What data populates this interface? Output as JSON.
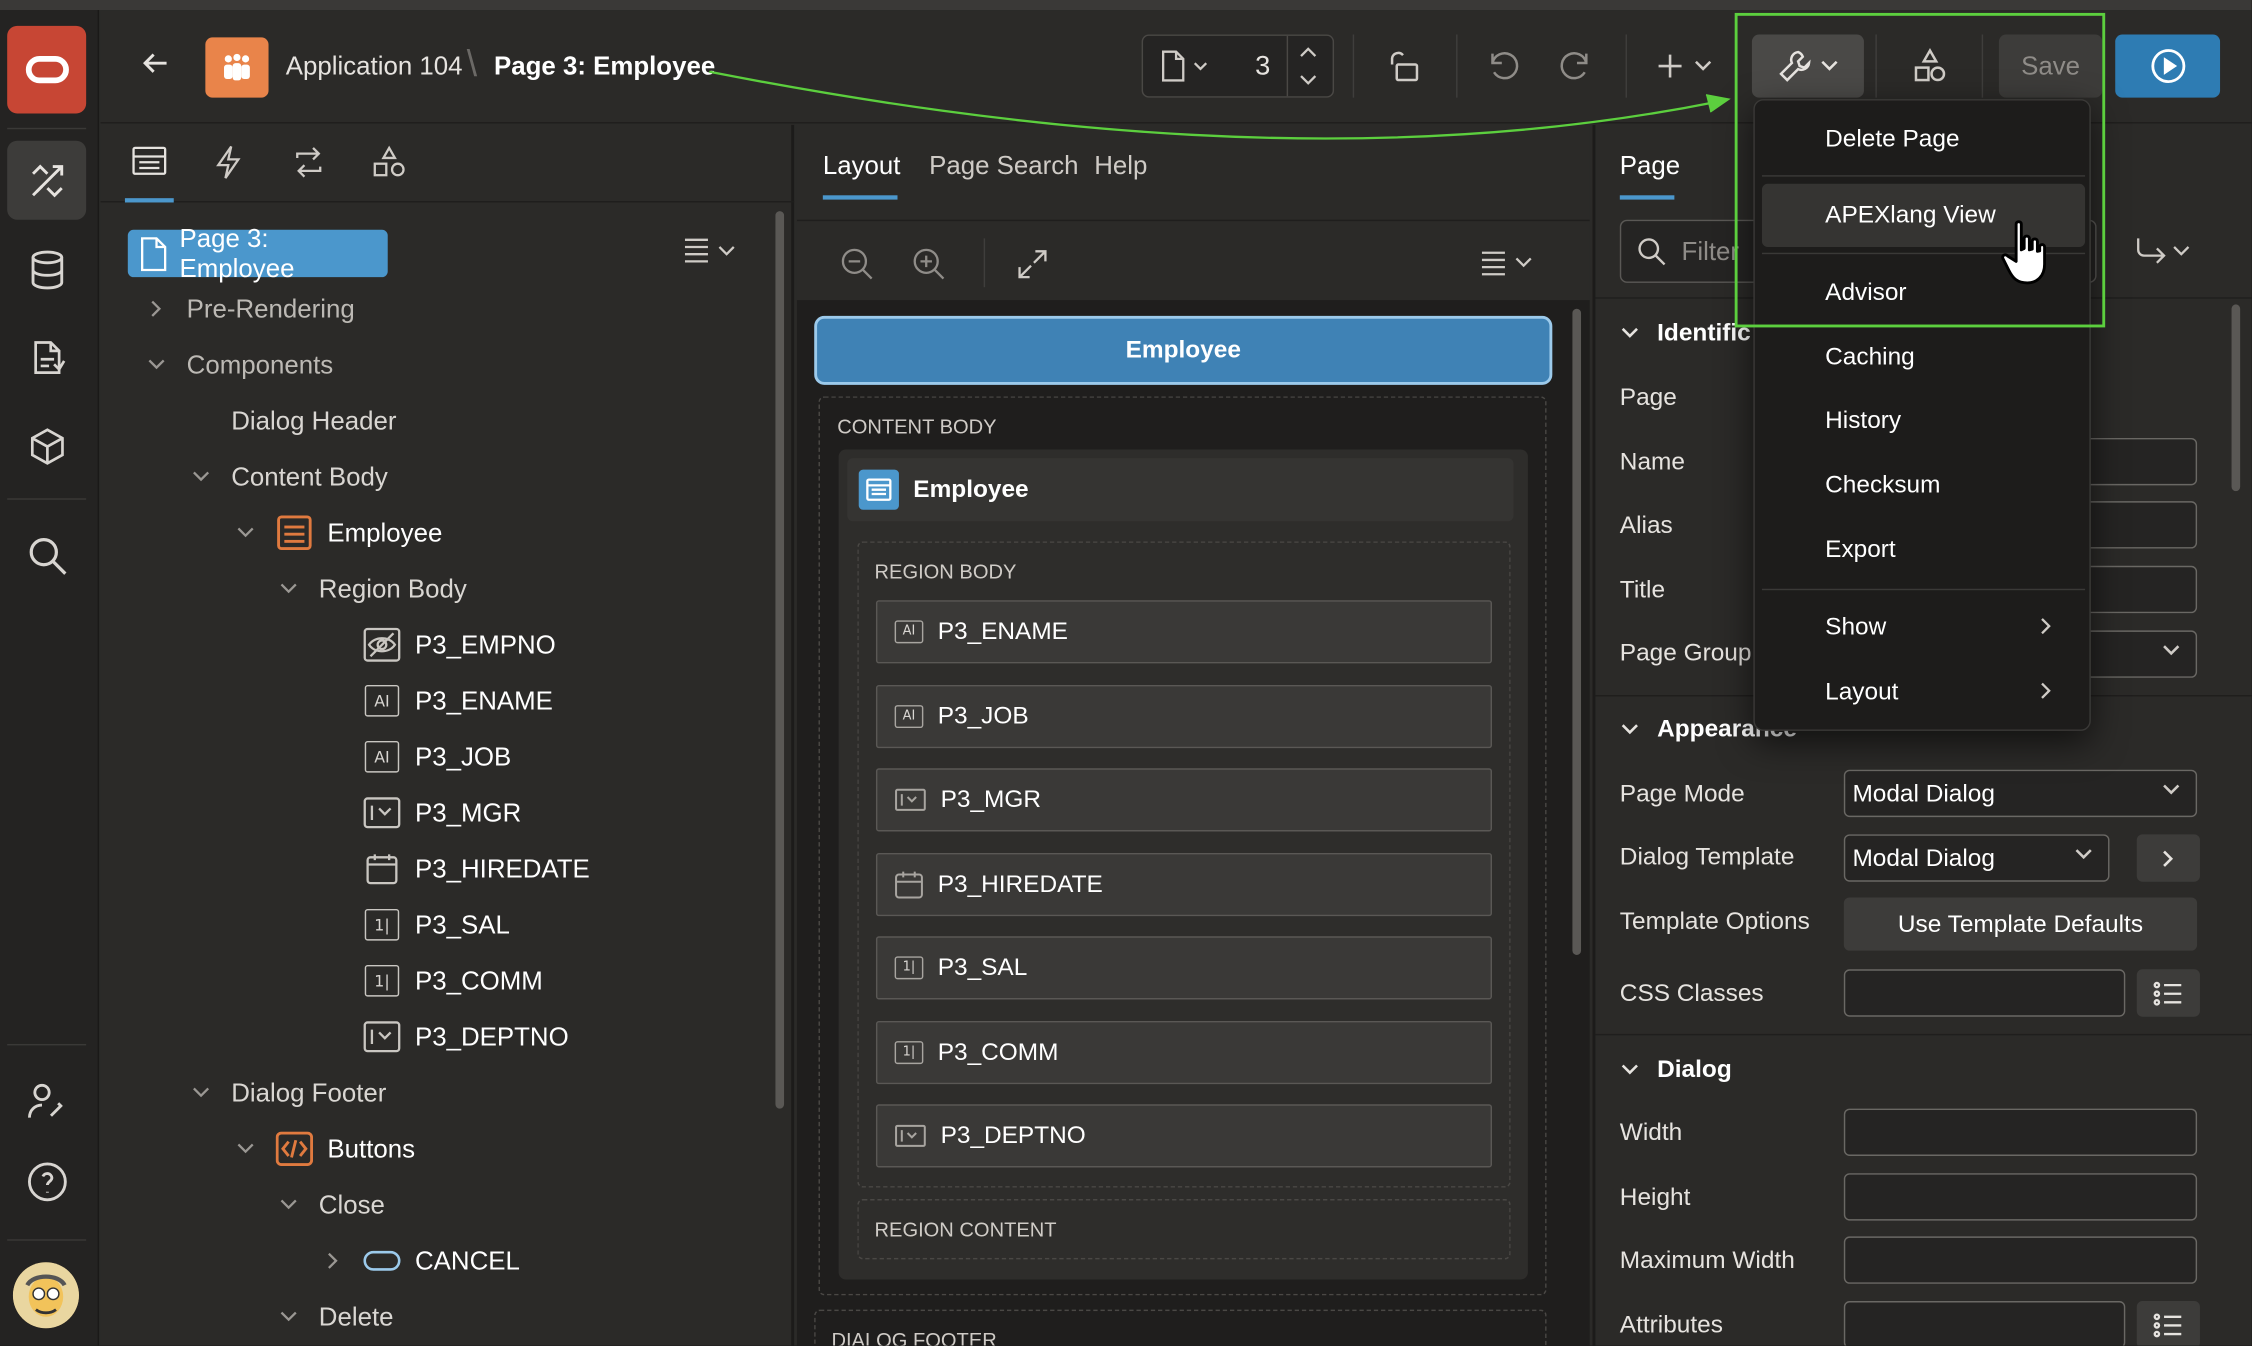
{
  "header": {
    "app_name": "Application 104",
    "page_name": "Page 3: Employee",
    "page_number": "3",
    "save_label": "Save"
  },
  "left_panel": {
    "root": "Page 3: Employee",
    "tree": [
      {
        "label": "Pre-Rendering",
        "kind": "group"
      },
      {
        "label": "Components",
        "kind": "group"
      },
      {
        "label": "Dialog Header",
        "kind": "node"
      },
      {
        "label": "Content Body",
        "kind": "node"
      },
      {
        "label": "Employee",
        "kind": "region"
      },
      {
        "label": "Region Body",
        "kind": "node"
      },
      {
        "label": "P3_EMPNO",
        "kind": "hidden-item"
      },
      {
        "label": "P3_ENAME",
        "kind": "text-item"
      },
      {
        "label": "P3_JOB",
        "kind": "text-item"
      },
      {
        "label": "P3_MGR",
        "kind": "select-item"
      },
      {
        "label": "P3_HIREDATE",
        "kind": "date-item"
      },
      {
        "label": "P3_SAL",
        "kind": "number-item"
      },
      {
        "label": "P3_COMM",
        "kind": "number-item"
      },
      {
        "label": "P3_DEPTNO",
        "kind": "select-item"
      },
      {
        "label": "Dialog Footer",
        "kind": "node"
      },
      {
        "label": "Buttons",
        "kind": "region-buttons"
      },
      {
        "label": "Close",
        "kind": "node"
      },
      {
        "label": "CANCEL",
        "kind": "button"
      },
      {
        "label": "Delete",
        "kind": "node"
      }
    ]
  },
  "center_panel": {
    "tabs": [
      "Layout",
      "Page Search",
      "Help"
    ],
    "dialog_title": "Employee",
    "content_body_label": "CONTENT BODY",
    "region_title": "Employee",
    "region_body_label": "REGION BODY",
    "items": [
      {
        "name": "P3_ENAME",
        "icon": "text-field-icon"
      },
      {
        "name": "P3_JOB",
        "icon": "text-field-icon"
      },
      {
        "name": "P3_MGR",
        "icon": "select-list-icon"
      },
      {
        "name": "P3_HIREDATE",
        "icon": "calendar-icon"
      },
      {
        "name": "P3_SAL",
        "icon": "number-field-icon"
      },
      {
        "name": "P3_COMM",
        "icon": "number-field-icon"
      },
      {
        "name": "P3_DEPTNO",
        "icon": "select-list-icon"
      }
    ],
    "region_content_label": "REGION CONTENT",
    "dialog_footer_label": "DIALOG FOOTER"
  },
  "right_panel": {
    "tab": "Page",
    "filter_placeholder": "Filter",
    "sections": {
      "identification": "Identific",
      "appearance": "Appearance",
      "dialog": "Dialog"
    },
    "labels": {
      "page": "Page",
      "name": "Name",
      "alias": "Alias",
      "title": "Title",
      "page_group": "Page Group",
      "page_mode": "Page Mode",
      "dialog_template": "Dialog Template",
      "template_options": "Template Options",
      "css_classes": "CSS Classes",
      "width": "Width",
      "height": "Height",
      "maximum_width": "Maximum Width",
      "attributes": "Attributes"
    },
    "values": {
      "page_mode": "Modal Dialog",
      "dialog_template": "Modal Dialog",
      "template_options": "Use Template Defaults"
    }
  },
  "utilities_menu": {
    "items": [
      {
        "label": "Delete Page"
      },
      {
        "label": "APEXlang View",
        "highlighted": true
      },
      {
        "label": "Advisor"
      },
      {
        "label": "Caching"
      },
      {
        "label": "History"
      },
      {
        "label": "Checksum"
      },
      {
        "label": "Export"
      },
      {
        "label": "Show",
        "submenu": true
      },
      {
        "label": "Layout",
        "submenu": true
      }
    ]
  },
  "colors": {
    "accent_blue": "#4b97cc",
    "oracle_red": "#c74634",
    "app_icon_orange": "#e9844a",
    "annotation_green": "#5ccf3e"
  }
}
